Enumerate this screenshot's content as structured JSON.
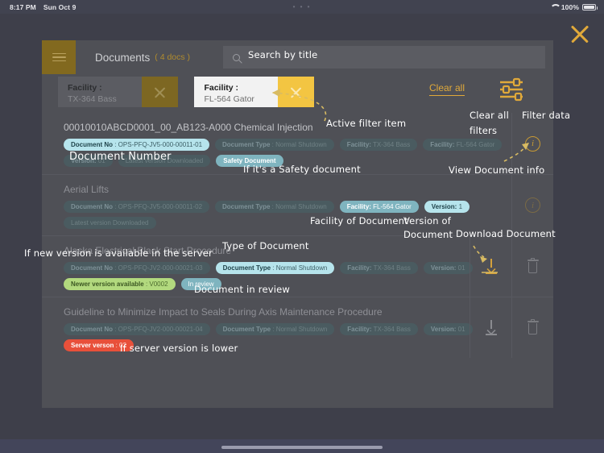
{
  "statusbar": {
    "time": "8:17 PM",
    "date": "Sun Oct 9",
    "center_dots": "• • •",
    "battery_pct": "100%",
    "wifi_icon": "wifi-icon",
    "battery_icon": "battery-icon"
  },
  "close_button": {
    "icon": "close-icon"
  },
  "header": {
    "menu_icon": "hamburger-menu-icon",
    "title": "Documents",
    "count": "( 4 docs )",
    "search": {
      "icon": "search-icon",
      "placeholder": "",
      "value": ""
    }
  },
  "filters": {
    "chips": [
      {
        "label": "Facility :",
        "value": "TX-364 Bass",
        "active": false,
        "clear_icon": "close-icon"
      },
      {
        "label": "Facility :",
        "value": "FL-564 Gator",
        "active": true,
        "clear_icon": "close-icon"
      }
    ],
    "clear_all_label": "Clear all",
    "filter_data_icon": "sliders-icon"
  },
  "documents": [
    {
      "title": "00010010ABCD0001_00_AB123-A000 Chemical Injection",
      "title_dim": false,
      "tags": [
        {
          "key": "Document No",
          "sep": " : ",
          "value": "OPS-PFQ-JV5-000-00011-01",
          "style": "t-hi-lite"
        },
        {
          "key": "Document Type",
          "sep": " : ",
          "value": "Normal Shutdown",
          "style": "t-dim"
        },
        {
          "key": "Facility:",
          "sep": "  ",
          "value": "TX-364 Bass",
          "style": "t-dim"
        },
        {
          "key": "Facility:",
          "sep": "  ",
          "value": "FL-564 Gator",
          "style": "t-dim"
        },
        {
          "key": "Version:",
          "sep": " ",
          "value": "01",
          "style": "t-dim"
        },
        {
          "key": "",
          "sep": "",
          "value": "Latest version Downloaded",
          "style": "t-dim"
        },
        {
          "key": "",
          "sep": "",
          "value": "Safety Document",
          "style": "t-safety"
        }
      ],
      "actions": [
        {
          "icon": "info-icon",
          "state": "active"
        }
      ]
    },
    {
      "title": "Aerial Lifts",
      "title_dim": true,
      "tags": [
        {
          "key": "Document No",
          "sep": " : ",
          "value": "OPS-PFQ-JV5-000-00011-02",
          "style": "t-dim"
        },
        {
          "key": "Document Type",
          "sep": " : ",
          "value": "Normal Shutdown",
          "style": "t-dim"
        },
        {
          "key": "Facility:",
          "sep": "  ",
          "value": "FL-564 Gator",
          "style": "t-hi-mid"
        },
        {
          "key": "Version:",
          "sep": " ",
          "value": "1",
          "style": "t-hi-lite"
        },
        {
          "key": "",
          "sep": "",
          "value": "Latest version Downloaded",
          "style": "t-dim"
        }
      ],
      "actions": [
        {
          "icon": "info-icon",
          "state": "dim"
        }
      ]
    },
    {
      "title": "Alaska Electrical Black  Start Procedure",
      "title_dim": true,
      "tags": [
        {
          "key": "Document No",
          "sep": " : ",
          "value": "OPS-PFQ-JV2-000-00021-03",
          "style": "t-dim"
        },
        {
          "key": "Document Type",
          "sep": " : ",
          "value": "Normal Shutdown",
          "style": "t-hi-lite"
        },
        {
          "key": "Facility:",
          "sep": "  ",
          "value": "TX-364 Bass",
          "style": "t-dim"
        },
        {
          "key": "Version:",
          "sep": " ",
          "value": "01",
          "style": "t-dim"
        },
        {
          "key": "Newer version available",
          "sep": " : ",
          "value": "V0002",
          "style": "t-green"
        },
        {
          "key": "",
          "sep": "",
          "value": "In review",
          "style": "t-hi-mid"
        }
      ],
      "actions": [
        {
          "icon": "download-icon",
          "state": "active"
        },
        {
          "icon": "trash-icon",
          "state": "dim"
        }
      ]
    },
    {
      "title": "Guideline to Minimize Impact to Seals During Axis Maintenance Procedure",
      "title_dim": true,
      "tags": [
        {
          "key": "Document No",
          "sep": " : ",
          "value": "OPS-PFQ-JV2-000-00021-04",
          "style": "t-dim"
        },
        {
          "key": "Document Type",
          "sep": " : ",
          "value": "Normal Shutdown",
          "style": "t-dim"
        },
        {
          "key": "Facility:",
          "sep": "  ",
          "value": "TX-364 Bass",
          "style": "t-dim"
        },
        {
          "key": "Version:",
          "sep": " ",
          "value": "01",
          "style": "t-dim"
        },
        {
          "key": "Server verson",
          "sep": " : ",
          "value": "02",
          "style": "t-red"
        }
      ],
      "actions": [
        {
          "icon": "download-icon",
          "state": "dim"
        },
        {
          "icon": "trash-icon",
          "state": "dim"
        }
      ]
    }
  ],
  "annotations": {
    "search_by_title": "Search by title",
    "active_filter_item": "Active filter item",
    "clear_all_filters_l1": "Clear all",
    "clear_all_filters_l2": "filters",
    "filter_data": "Filter data",
    "view_document_info": "View Document info",
    "document_number": "Document Number",
    "if_safety_document": "If it's  a Safety document",
    "facility_of_document": "Facility of Document",
    "version_of_document_l1": "Version of",
    "version_of_document_l2": "Document",
    "type_of_document": "Type of Document",
    "download_document": "Download Document",
    "if_new_version": "If new version is available in the server",
    "document_in_review": "Document in review",
    "if_server_version_lower": "If server version is lower"
  }
}
